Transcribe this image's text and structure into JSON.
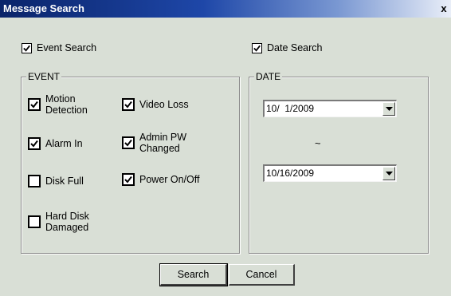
{
  "window": {
    "title": "Message Search",
    "close_label": "x"
  },
  "search_options": {
    "event_search": {
      "label": "Event Search",
      "checked": true
    },
    "date_search": {
      "label": "Date Search",
      "checked": true
    }
  },
  "event_group": {
    "title": "EVENT",
    "items": [
      {
        "label": "Motion\nDetection",
        "checked": true
      },
      {
        "label": "Video Loss",
        "checked": true
      },
      {
        "label": "Alarm In",
        "checked": true
      },
      {
        "label": "Admin PW\nChanged",
        "checked": true
      },
      {
        "label": "Disk Full",
        "checked": false
      },
      {
        "label": "Power On/Off",
        "checked": true
      },
      {
        "label": "Hard Disk\nDamaged",
        "checked": false
      }
    ]
  },
  "date_group": {
    "title": "DATE",
    "start_date": "10/  1/2009",
    "separator": "~",
    "end_date": "10/16/2009"
  },
  "buttons": {
    "search": "Search",
    "cancel": "Cancel"
  },
  "icons": {
    "checkbox": "check-icon",
    "dropdown": "chevron-down-icon"
  }
}
